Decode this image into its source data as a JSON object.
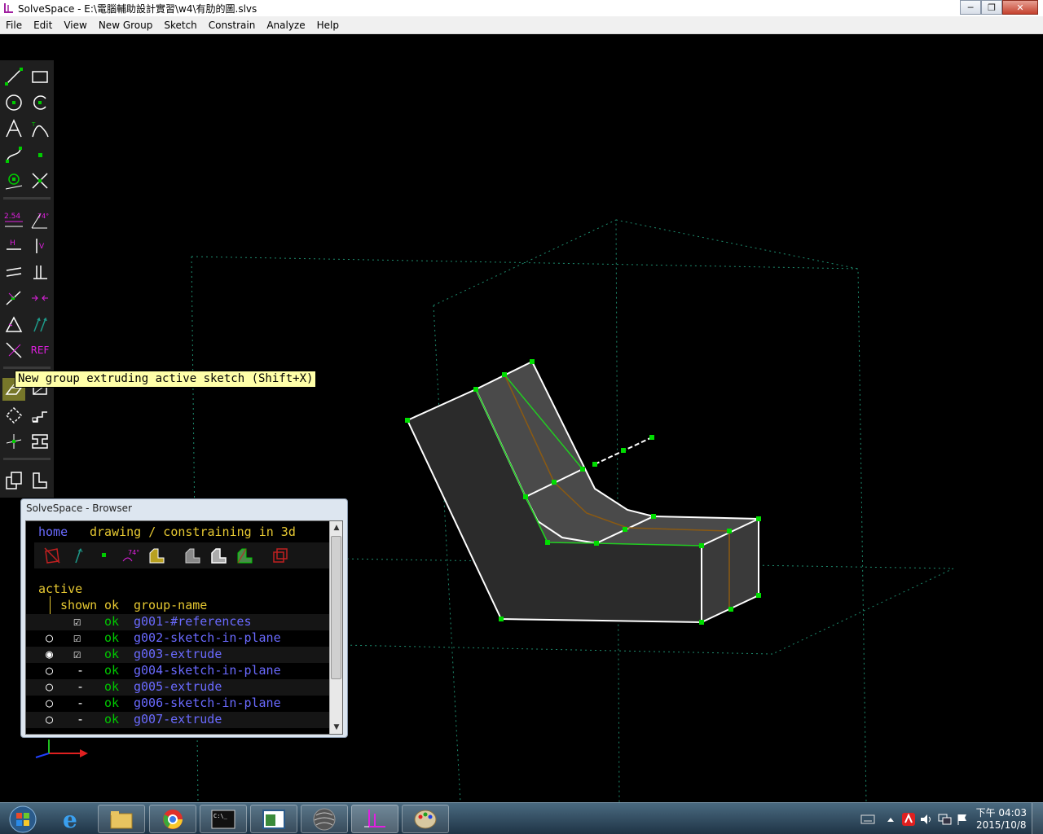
{
  "window": {
    "title": "SolveSpace - E:\\電腦輔助設計實習\\w4\\有肋的圖.slvs",
    "minimize": "─",
    "maximize": "❐",
    "close": "✕"
  },
  "menu": [
    "File",
    "Edit",
    "View",
    "New Group",
    "Sketch",
    "Constrain",
    "Analyze",
    "Help"
  ],
  "toolbar": {
    "tooltip": "New group extruding active sketch (Shift+X)",
    "dim_label": "2.54",
    "angle_label": "74°",
    "h_label": "H",
    "v_label": "V",
    "ref_label": "REF"
  },
  "browser": {
    "title": "SolveSpace - Browser",
    "home": "home",
    "heading": "drawing / constraining in 3d",
    "active_label": "active",
    "col_shown": "shown",
    "col_ok": "ok",
    "col_name": "group-name",
    "groups": [
      {
        "active": "",
        "shown": "☑",
        "ok": "ok",
        "name": "g001-#references"
      },
      {
        "active": "○",
        "shown": "☑",
        "ok": "ok",
        "name": "g002-sketch-in-plane"
      },
      {
        "active": "◉",
        "shown": "☑",
        "ok": "ok",
        "name": "g003-extrude"
      },
      {
        "active": "○",
        "shown": "-",
        "ok": "ok",
        "name": "g004-sketch-in-plane"
      },
      {
        "active": "○",
        "shown": "-",
        "ok": "ok",
        "name": "g005-extrude"
      },
      {
        "active": "○",
        "shown": "-",
        "ok": "ok",
        "name": "g006-sketch-in-plane"
      },
      {
        "active": "○",
        "shown": "-",
        "ok": "ok",
        "name": "g007-extrude"
      }
    ]
  },
  "taskbar": {
    "time": "下午 04:03",
    "date": "2015/10/8"
  },
  "colors": {
    "accent_green": "#00cc00",
    "group_blue": "#6a6aff",
    "ok_green": "#00c800",
    "label_yellow": "#e6c832",
    "constraint_magenta": "#e020e0"
  }
}
